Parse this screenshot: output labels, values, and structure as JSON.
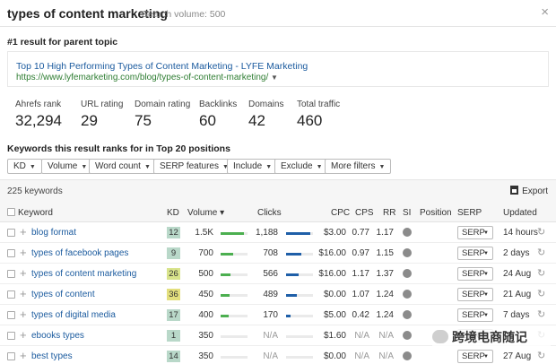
{
  "header": {
    "title": "types of content marketing",
    "search_volume": "Search volume: 500",
    "close_glyph": "×"
  },
  "parent_topic": {
    "label": "#1 result for parent topic",
    "result_title": "Top 10 High Performing Types of Content Marketing - LYFE Marketing",
    "result_url": "https://www.lyfemarketing.com/blog/types-of-content-marketing/",
    "url_caret": "▼"
  },
  "metrics": [
    {
      "label": "Ahrefs rank",
      "value": "32,294"
    },
    {
      "label": "URL rating",
      "value": "29"
    },
    {
      "label": "Domain rating",
      "value": "75"
    },
    {
      "label": "Backlinks",
      "value": "60"
    },
    {
      "label": "Domains",
      "value": "42"
    },
    {
      "label": "Total traffic",
      "value": "460"
    }
  ],
  "keywords_section": {
    "heading": "Keywords this result ranks for in Top 20 positions",
    "filters": [
      "KD",
      "Volume",
      "Word count",
      "SERP features",
      "Include",
      "Exclude",
      "More filters"
    ],
    "filter_arrow": "▼",
    "count_text": "225 keywords",
    "export_label": "Export"
  },
  "table": {
    "columns": {
      "keyword": "Keyword",
      "kd": "KD",
      "volume": "Volume ▾",
      "clicks": "Clicks",
      "cpc": "CPC",
      "cps": "CPS",
      "rr": "RR",
      "si": "SI",
      "position": "Position",
      "serp": "SERP",
      "updated": "Updated"
    },
    "rows": [
      {
        "keyword": "blog format",
        "kd": "12",
        "volume": "1.5K",
        "clicks": "1,188",
        "cpc": "$3.00",
        "cps": "0.77",
        "rr": "1.17",
        "serp": "SERP",
        "updated": "14 hours",
        "kd_color": "#b9d8c9",
        "volume_level": 0.85,
        "clicks_level": 0.9
      },
      {
        "keyword": "types of facebook pages",
        "kd": "9",
        "volume": "700",
        "clicks": "708",
        "cpc": "$16.00",
        "cps": "0.97",
        "rr": "1.15",
        "serp": "SERP",
        "updated": "2 days",
        "kd_color": "#b9d8c9",
        "volume_level": 0.45,
        "clicks_level": 0.55
      },
      {
        "keyword": "types of content marketing",
        "kd": "26",
        "volume": "500",
        "clicks": "566",
        "cpc": "$16.00",
        "cps": "1.17",
        "rr": "1.37",
        "serp": "SERP",
        "updated": "24 Aug",
        "kd_color": "#d8e38b",
        "volume_level": 0.35,
        "clicks_level": 0.45
      },
      {
        "keyword": "types of content",
        "kd": "36",
        "volume": "450",
        "clicks": "489",
        "cpc": "$0.00",
        "cps": "1.07",
        "rr": "1.24",
        "serp": "SERP",
        "updated": "21 Aug",
        "kd_color": "#e3df7d",
        "volume_level": 0.33,
        "clicks_level": 0.4
      },
      {
        "keyword": "types of digital media",
        "kd": "17",
        "volume": "400",
        "clicks": "170",
        "cpc": "$5.00",
        "cps": "0.42",
        "rr": "1.24",
        "serp": "SERP",
        "updated": "7 days",
        "kd_color": "#b9d8c9",
        "volume_level": 0.3,
        "clicks_level": 0.15
      },
      {
        "keyword": "ebooks types",
        "kd": "1",
        "volume": "350",
        "clicks": "N/A",
        "cpc": "$1.60",
        "cps": "N/A",
        "rr": "N/A",
        "serp": "SERP",
        "updated": "",
        "kd_color": "#b9d8c9",
        "volume_level": 0.0,
        "clicks_level": 0.0
      },
      {
        "keyword": "best types",
        "kd": "14",
        "volume": "350",
        "clicks": "N/A",
        "cpc": "$0.00",
        "cps": "N/A",
        "rr": "N/A",
        "serp": "SERP",
        "updated": "27 Aug",
        "kd_color": "#b9d8c9",
        "volume_level": 0.0,
        "clicks_level": 0.0
      }
    ]
  },
  "colors": {
    "link": "#1a5a9e",
    "url_green": "#2e7d32",
    "volume_bar": "#4caf50",
    "clicks_bar": "#1f5fa8"
  },
  "icons": {
    "close": "close-icon",
    "export": "export-icon",
    "si": "si-indicator-icon",
    "refresh": "refresh-icon",
    "add": "plus-icon"
  },
  "watermark": "跨境电商随记"
}
